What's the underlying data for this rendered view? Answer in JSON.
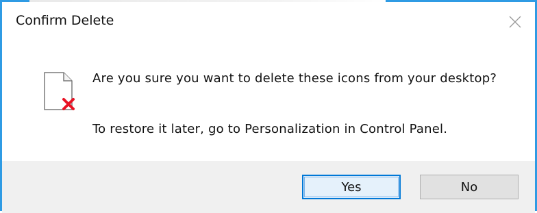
{
  "dialog": {
    "title": "Confirm Delete",
    "close_icon": "close-icon",
    "file_icon": "deleted-file-icon",
    "message_primary": "Are you sure you want to delete these icons from your desktop?",
    "message_secondary": "To restore it later, go to Personalization in Control Panel.",
    "buttons": {
      "yes_label": "Yes",
      "no_label": "No"
    },
    "colors": {
      "accent_border": "#2f9be4",
      "delete_x": "#e81123",
      "footer_bg": "#f0f0f0"
    }
  }
}
